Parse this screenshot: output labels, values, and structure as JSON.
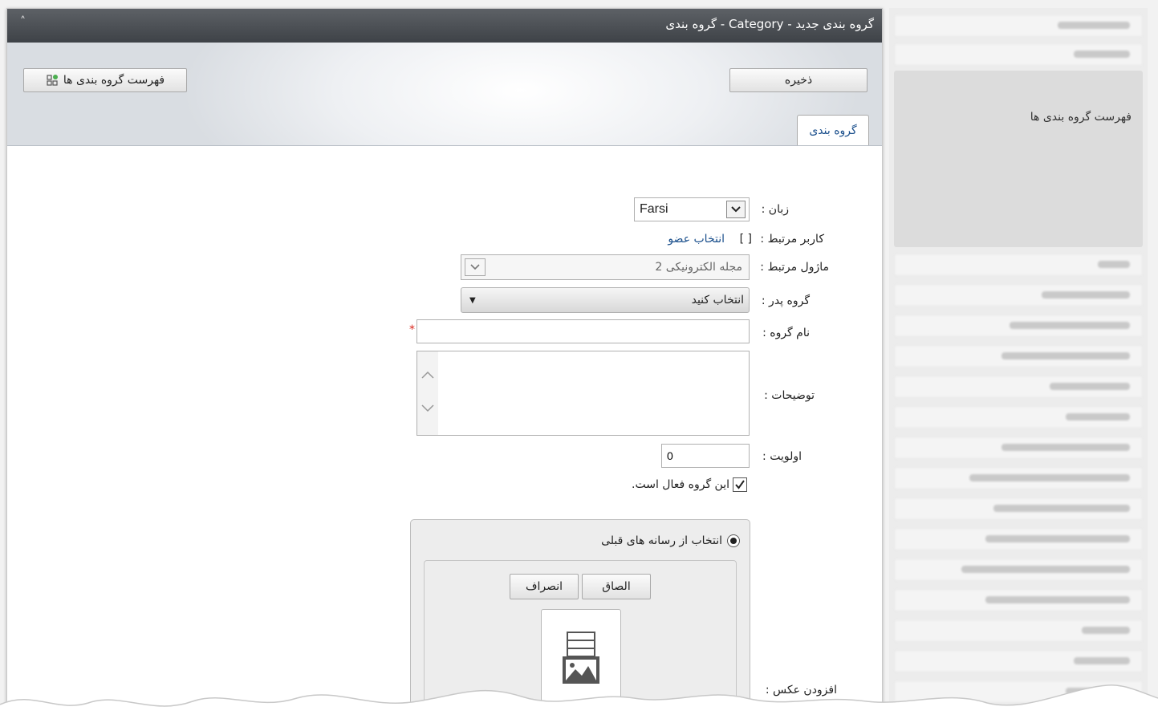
{
  "header": {
    "title": "گروه بندی - Category - گروه بندی جدید",
    "collapse_icon": "˄"
  },
  "toolbar": {
    "save_label": "ذخیره",
    "list_label": "فهرست گروه بندی ها"
  },
  "tabs": [
    {
      "label": "گروه بندی"
    }
  ],
  "form": {
    "language_label": "زبان :",
    "language_value": "Farsi",
    "related_user_label": "کاربر مرتبط :",
    "related_user_brackets": "[ ]",
    "select_member_link": "انتخاب عضو",
    "related_module_label": "ماژول مرتبط :",
    "related_module_value": "مجله الکترونیکی 2",
    "parent_group_label": "گروه پدر :",
    "parent_group_value": "انتخاب کنید",
    "group_name_label": "نام گروه :",
    "group_name_value": "",
    "required_mark": "*",
    "description_label": "توضیحات :",
    "priority_label": "اولویت :",
    "priority_value": "0",
    "active_checkbox_label": "این گروه فعال است.",
    "active_checked": true,
    "add_image_label": "افزودن عکس :",
    "media": {
      "radio_label": "انتخاب از رسانه های قبلی",
      "attach_button": "الصاق",
      "cancel_button": "انصراف"
    }
  },
  "sidebar": {
    "visible_link": "فهرست گروه بندی ها"
  },
  "colors": {
    "titlebar": "#4a4e53",
    "link": "#1a4f8c",
    "required": "#d9261c"
  }
}
